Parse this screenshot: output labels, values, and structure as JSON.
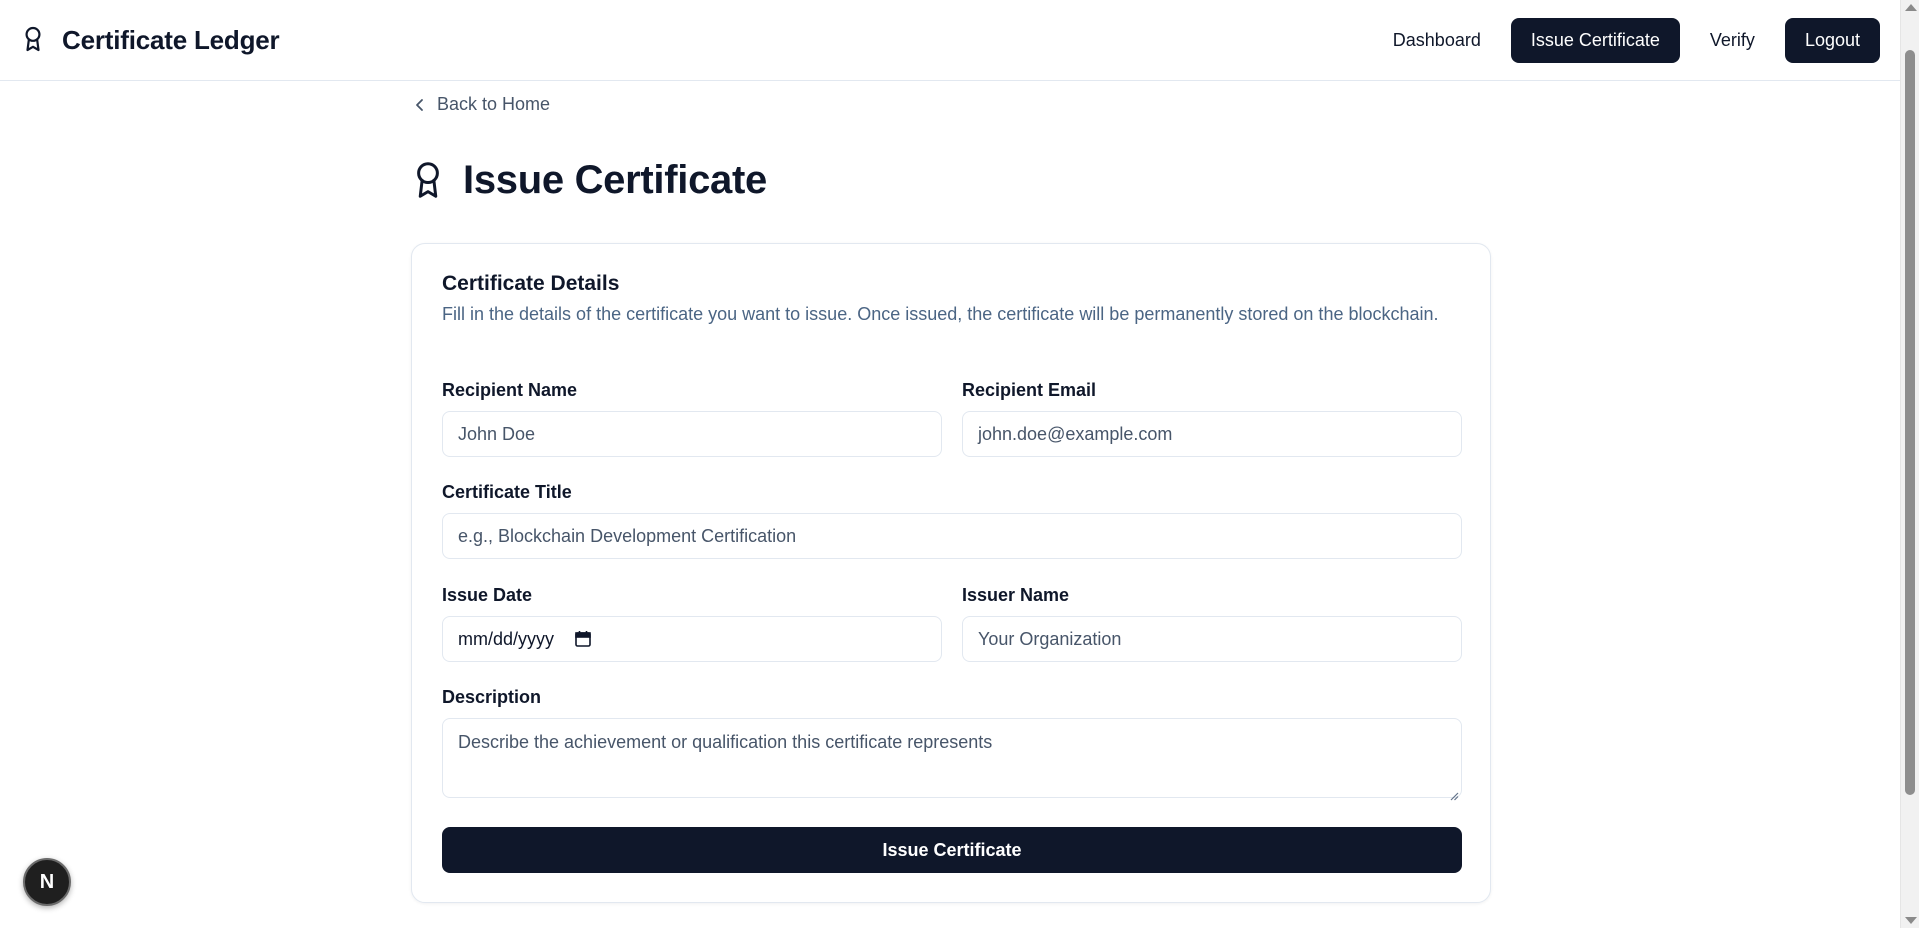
{
  "header": {
    "brand_title": "Certificate Ledger",
    "brand_icon": "award-icon",
    "nav": {
      "dashboard": "Dashboard",
      "issue_certificate": "Issue Certificate",
      "verify": "Verify",
      "logout": "Logout"
    }
  },
  "back_link": {
    "label": "Back to Home",
    "icon": "chevron-left-icon"
  },
  "page": {
    "title": "Issue Certificate",
    "icon": "award-icon"
  },
  "card": {
    "title": "Certificate Details",
    "description": "Fill in the details of the certificate you want to issue. Once issued, the certificate will be permanently stored on the blockchain.",
    "fields": {
      "recipient_name": {
        "label": "Recipient Name",
        "placeholder": "John Doe"
      },
      "recipient_email": {
        "label": "Recipient Email",
        "placeholder": "john.doe@example.com"
      },
      "certificate_title": {
        "label": "Certificate Title",
        "placeholder": "e.g., Blockchain Development Certification"
      },
      "issue_date": {
        "label": "Issue Date",
        "placeholder": "mm/dd/yyyy"
      },
      "issuer_name": {
        "label": "Issuer Name",
        "placeholder": "Your Organization"
      },
      "description": {
        "label": "Description",
        "placeholder": "Describe the achievement or qualification this certificate represents"
      }
    },
    "submit_label": "Issue Certificate"
  },
  "badge": {
    "letter": "N"
  },
  "colors": {
    "primary_dark": "#0f172a",
    "muted_text": "#475569",
    "border": "#e2e8f0"
  }
}
